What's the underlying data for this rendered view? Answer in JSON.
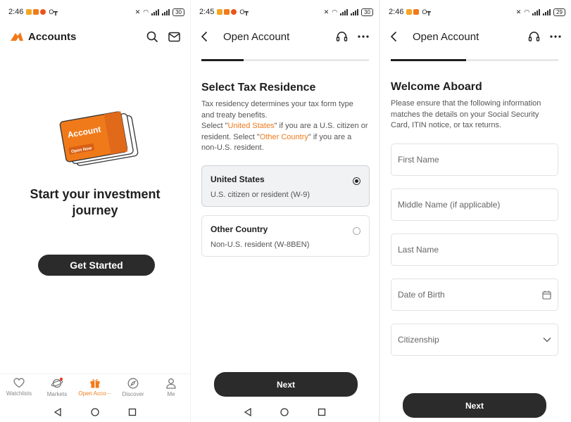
{
  "status": {
    "screen1_time": "2:46",
    "screen2_time": "2:45",
    "screen3_time": "2:46",
    "screen1_battery": "30",
    "screen2_battery": "30",
    "screen3_battery": "29"
  },
  "screen1": {
    "title": "Accounts",
    "card_label": "Account",
    "card_sub": "Open Now",
    "hero_line1": "Start your investment",
    "hero_line2": "journey",
    "cta": "Get Started",
    "tabs": [
      {
        "label": "Watchlists",
        "icon": "heart-icon"
      },
      {
        "label": "Markets",
        "icon": "planet-icon"
      },
      {
        "label": "Open Acco···",
        "icon": "gift-icon"
      },
      {
        "label": "Discover",
        "icon": "compass-icon"
      },
      {
        "label": "Me",
        "icon": "person-icon"
      }
    ]
  },
  "screen2": {
    "title": "Open Account",
    "heading": "Select Tax Residence",
    "desc_line1": "Tax residency determines your tax form type",
    "desc_line2": "and treaty benefits.",
    "desc_select": "Select \"",
    "desc_us": "United States",
    "desc_mid": "\" if you are a U.S. citizen or",
    "desc_resident": "resident. Select \"",
    "desc_other": "Other Country",
    "desc_end": "\" if you are a",
    "desc_last": "non-U.S. resident.",
    "options": [
      {
        "title": "United States",
        "sub": "U.S. citizen or resident (W-9)",
        "selected": true
      },
      {
        "title": "Other Country",
        "sub": "Non-U.S. resident (W-8BEN)",
        "selected": false
      }
    ],
    "next": "Next",
    "progress_fraction": 0.25
  },
  "screen3": {
    "title": "Open Account",
    "heading": "Welcome Aboard",
    "desc_line1": "Please ensure that the following information",
    "desc_line2": "matches the details on your Social Security",
    "desc_line3": "Card, ITIN notice, or tax returns.",
    "fields": [
      {
        "placeholder": "First Name"
      },
      {
        "placeholder": "Middle Name (if applicable)"
      },
      {
        "placeholder": "Last Name"
      },
      {
        "placeholder": "Date of Birth",
        "icon": "calendar-icon"
      },
      {
        "placeholder": "Citizenship",
        "icon": "chevron-down-icon"
      }
    ],
    "next": "Next",
    "progress_fraction": 0.45
  },
  "colors": {
    "accent": "#f07a1a",
    "dark_button": "#2b2b2b"
  }
}
